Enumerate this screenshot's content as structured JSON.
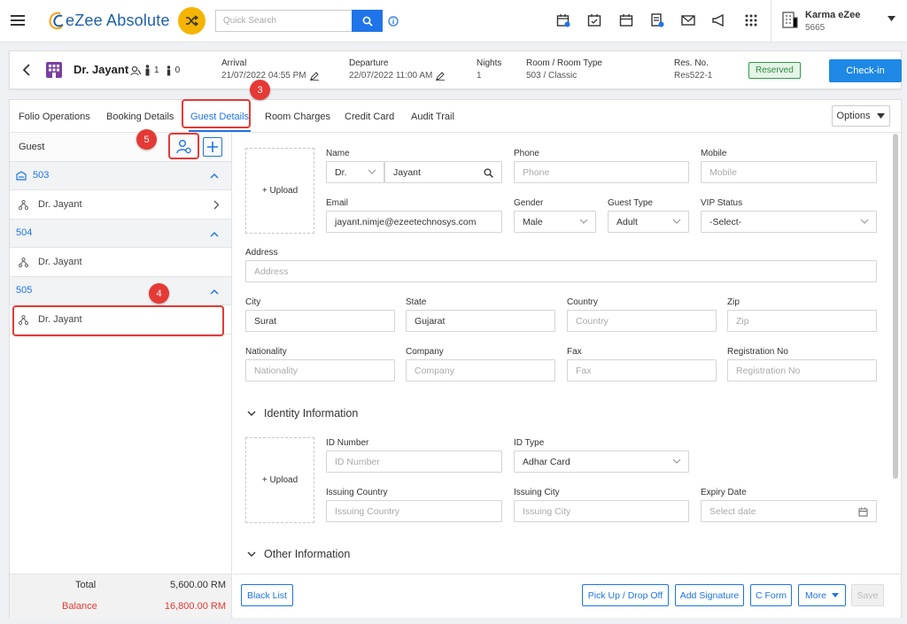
{
  "app": {
    "logo": "eZee Absolute",
    "search_placeholder": "Quick Search",
    "user_name": "Karma eZee",
    "user_id": "5665",
    "accent": "#1e74e8"
  },
  "header": {
    "guest_name": "Dr. Jayant",
    "adults": "1",
    "children": "0",
    "arrival_label": "Arrival",
    "arrival_value": "21/07/2022 04:55 PM",
    "departure_label": "Departure",
    "departure_value": "22/07/2022 11:00 AM",
    "nights_label": "Nights",
    "nights_value": "1",
    "room_label": "Room / Room Type",
    "room_value": "503 / Classic",
    "resno_label": "Res. No.",
    "resno_value": "Res522-1",
    "status": "Reserved",
    "checkin": "Check-in"
  },
  "tabs": [
    "Folio Operations",
    "Booking Details",
    "Guest Details",
    "Room Charges",
    "Credit Card",
    "Audit Trail"
  ],
  "options": "Options",
  "left": {
    "title": "Guest",
    "rooms": [
      {
        "no": "503",
        "guest": "Dr. Jayant"
      },
      {
        "no": "504",
        "guest": "Dr. Jayant"
      },
      {
        "no": "505",
        "guest": "Dr. Jayant"
      }
    ],
    "total_label": "Total",
    "total_value": "5,600.00 RM",
    "balance_label": "Balance",
    "balance_value": "16,800.00 RM"
  },
  "form": {
    "upload": "+ Upload",
    "name_label": "Name",
    "salutation": "Dr.",
    "name_value": "Jayant",
    "phone_label": "Phone",
    "phone_ph": "Phone",
    "mobile_label": "Mobile",
    "mobile_ph": "Mobile",
    "email_label": "Email",
    "email_value": "jayant.nimje@ezeetechnosys.com",
    "gender_label": "Gender",
    "gender_value": "Male",
    "gtype_label": "Guest Type",
    "gtype_value": "Adult",
    "vip_label": "VIP Status",
    "vip_value": "-Select-",
    "address_label": "Address",
    "address_ph": "Address",
    "city_label": "City",
    "city_value": "Surat",
    "state_label": "State",
    "state_value": "Gujarat",
    "country_label": "Country",
    "country_ph": "Country",
    "zip_label": "Zip",
    "zip_ph": "Zip",
    "nat_label": "Nationality",
    "nat_ph": "Nationality",
    "company_label": "Company",
    "company_ph": "Company",
    "fax_label": "Fax",
    "fax_ph": "Fax",
    "reg_label": "Registration No",
    "reg_ph": "Registration No",
    "identity_title": "Identity Information",
    "idno_label": "ID Number",
    "idno_ph": "ID Number",
    "idtype_label": "ID Type",
    "idtype_value": "Adhar Card",
    "icountry_label": "Issuing Country",
    "icountry_ph": "Issuing Country",
    "icity_label": "Issuing City",
    "icity_ph": "Issuing City",
    "expiry_label": "Expiry Date",
    "expiry_ph": "Select date",
    "other_title": "Other Information"
  },
  "buttons": {
    "blacklist": "Black List",
    "pickup": "Pick Up / Drop Off",
    "signature": "Add Signature",
    "cform": "C Form",
    "more": "More",
    "save": "Save"
  },
  "markers": [
    "3",
    "4",
    "5"
  ]
}
